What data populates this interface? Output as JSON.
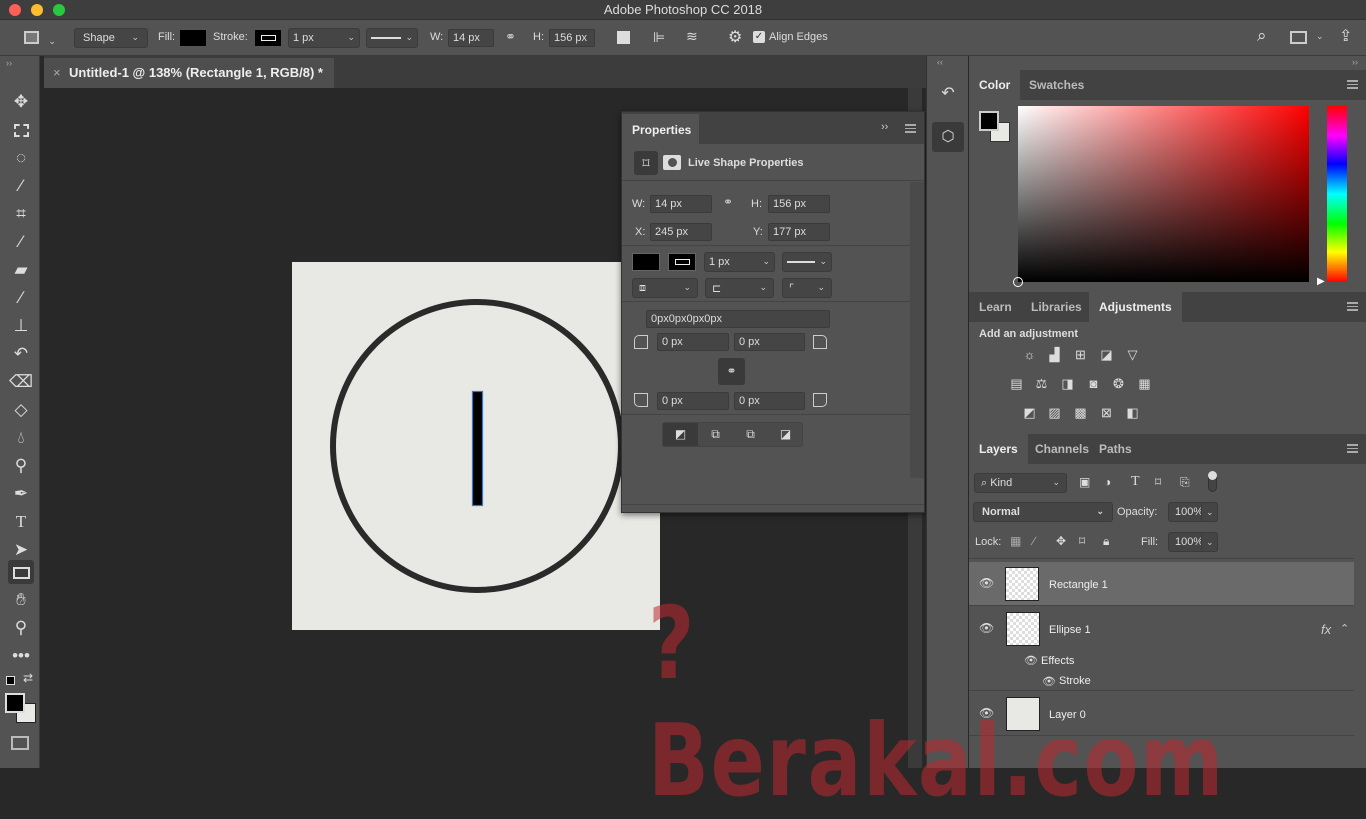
{
  "app": {
    "title": "Adobe Photoshop CC 2018"
  },
  "window_controls": {
    "close": "#fe5f57",
    "minimize": "#febc2e",
    "maximize": "#28c840"
  },
  "options_bar": {
    "tool_mode": "Shape",
    "fill_label": "Fill:",
    "stroke_label": "Stroke:",
    "stroke_width": "1 px",
    "w_label": "W:",
    "w_value": "14 px",
    "h_label": "H:",
    "h_value": "156 px",
    "align_edges_label": "Align Edges",
    "align_edges_checked": true
  },
  "document": {
    "tab_title": "Untitled-1 @ 138% (Rectangle 1, RGB/8) *",
    "canvas_color": "#e8e8e4"
  },
  "tools": [
    "move",
    "marquee",
    "lasso",
    "magic-wand",
    "crop",
    "eyedropper",
    "healing-brush",
    "brush",
    "clone-stamp",
    "history-brush",
    "eraser",
    "paint-bucket",
    "blur",
    "dodge",
    "pen",
    "type",
    "path-selection",
    "rectangle",
    "hand",
    "zoom",
    "more"
  ],
  "properties": {
    "title": "Properties",
    "section_title": "Live Shape Properties",
    "w_label": "W:",
    "w": "14 px",
    "h_label": "H:",
    "h": "156 px",
    "x_label": "X:",
    "x": "245 px",
    "y_label": "Y:",
    "y": "177 px",
    "stroke_width": "1 px",
    "corner_summary": "0px0px0px0px",
    "corners": [
      "0 px",
      "0 px",
      "0 px",
      "0 px"
    ]
  },
  "color_panel": {
    "tabs": [
      "Color",
      "Swatches"
    ],
    "active_tab": "Color",
    "foreground": "#000000",
    "background": "#e8e8e4",
    "hue_color": "#ff0000"
  },
  "adjustments_panel": {
    "tabs": [
      "Learn",
      "Libraries",
      "Adjustments"
    ],
    "active_tab": "Adjustments",
    "heading": "Add an adjustment",
    "rows": [
      [
        "brightness-contrast",
        "levels",
        "curves",
        "exposure",
        "vibrance"
      ],
      [
        "hue-saturation",
        "color-balance",
        "black-white",
        "photo-filter",
        "channel-mixer",
        "color-lookup"
      ],
      [
        "invert",
        "posterize",
        "threshold",
        "selective-color",
        "gradient-map"
      ]
    ]
  },
  "layers_panel": {
    "tabs": [
      "Layers",
      "Channels",
      "Paths"
    ],
    "active_tab": "Layers",
    "filter_kind": "Kind",
    "blend_mode": "Normal",
    "opacity_label": "Opacity:",
    "opacity": "100%",
    "lock_label": "Lock:",
    "fill_label": "Fill:",
    "fill": "100%",
    "layers": [
      {
        "name": "Rectangle 1",
        "selected": true
      },
      {
        "name": "Ellipse 1",
        "fx": "fx",
        "effects_label": "Effects",
        "effect": "Stroke"
      },
      {
        "name": "Layer 0"
      }
    ]
  },
  "watermark": {
    "text": "?Berakal.com"
  }
}
